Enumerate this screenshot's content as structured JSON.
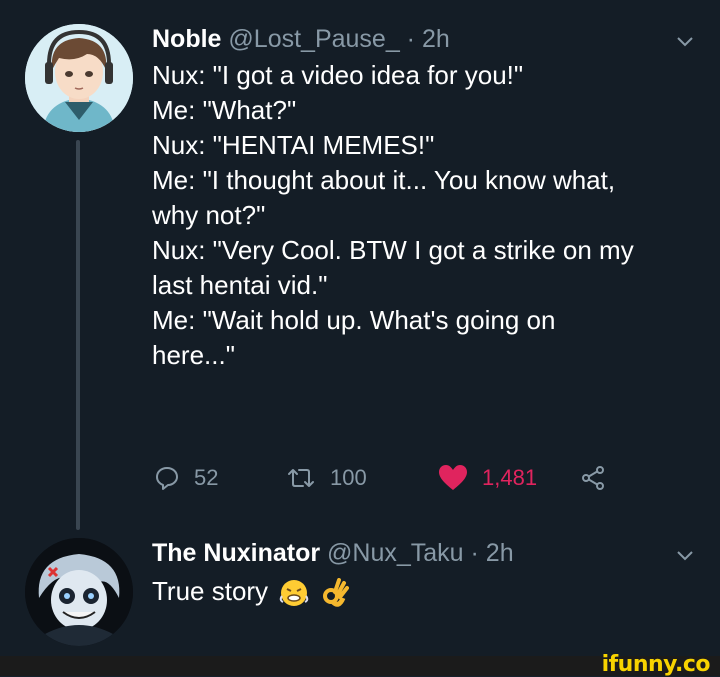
{
  "tweets": [
    {
      "name": "Noble",
      "handle": "@Lost_Pause_",
      "time": " · 2h",
      "lines": [
        "Nux: \"I got a video idea for you!\"",
        "Me: \"What?\"",
        "Nux: \"HENTAI MEMES!\"",
        "Me: \"I thought about it... You know what,",
        "why not?\"",
        "Nux: \"Very Cool. BTW I got a strike on my",
        "last hentai vid.\"",
        "Me: \"Wait hold up. What's going on",
        "here...\""
      ],
      "replies": "52",
      "retweets": "100",
      "likes": "1,481"
    },
    {
      "name": "The Nuxinator",
      "handle": "@Nux_Taku",
      "time": " · 2h",
      "text": "True story"
    }
  ],
  "watermark": "ifunny.co",
  "icons": [
    "chevron-down-icon",
    "reply-icon",
    "retweet-icon",
    "heart-icon",
    "share-icon",
    "face-emoji-icon",
    "ok-hand-emoji-icon"
  ],
  "colors": {
    "background": "#141d26",
    "text": "#ffffff",
    "secondary": "#8899a6",
    "like": "#e0245e",
    "watermark": "#f7d300"
  }
}
